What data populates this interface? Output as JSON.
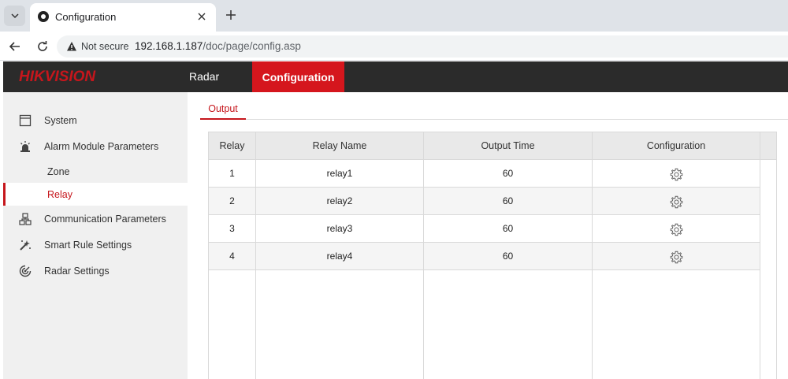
{
  "browser": {
    "tab_title": "Configuration",
    "security_label": "Not secure",
    "url_host": "192.168.1.187",
    "url_path": "/doc/page/config.asp"
  },
  "header": {
    "logo_hik": "HIK",
    "logo_vision": "VISION",
    "nav_items": [
      "Radar",
      "Configuration"
    ]
  },
  "sidebar": {
    "items": [
      {
        "label": "System",
        "icon": "system-icon"
      },
      {
        "label": "Alarm Module Parameters",
        "icon": "alarm-icon"
      },
      {
        "label": "Zone"
      },
      {
        "label": "Relay"
      },
      {
        "label": "Communication Parameters",
        "icon": "network-icon"
      },
      {
        "label": "Smart Rule Settings",
        "icon": "smart-rule-icon"
      },
      {
        "label": "Radar Settings",
        "icon": "radar-icon"
      }
    ]
  },
  "main": {
    "subtab": "Output",
    "table": {
      "columns": [
        "Relay",
        "Relay Name",
        "Output Time",
        "Configuration"
      ],
      "rows": [
        [
          "1",
          "relay1",
          "60"
        ],
        [
          "2",
          "relay2",
          "60"
        ],
        [
          "3",
          "relay3",
          "60"
        ],
        [
          "4",
          "relay4",
          "60"
        ]
      ]
    }
  },
  "colors": {
    "brand_red": "#c6161c",
    "header_bg": "#2b2b2b",
    "sidebar_bg": "#f0f0f0"
  }
}
